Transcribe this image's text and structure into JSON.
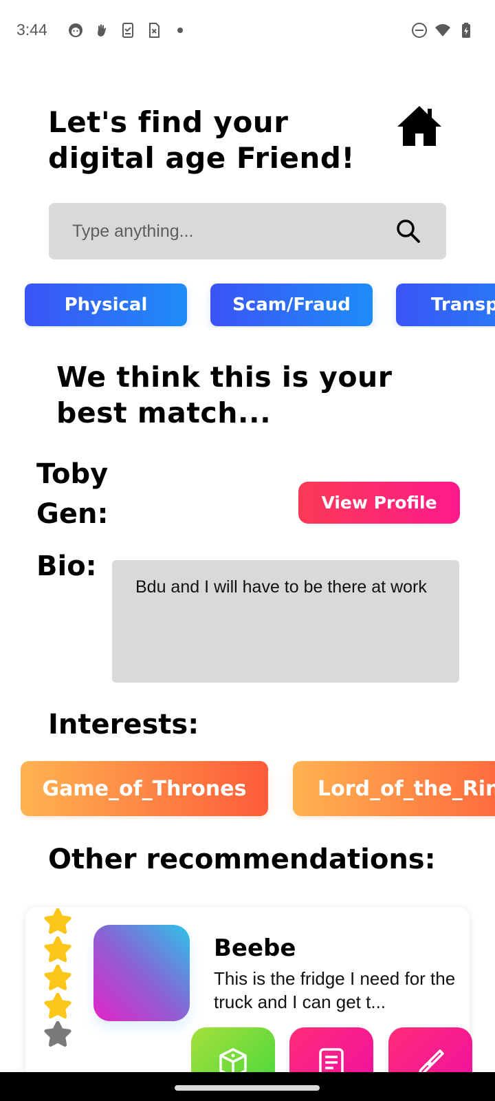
{
  "status_bar": {
    "time": "3:44",
    "left_icons": [
      "face-icon",
      "hand-icon",
      "clipboard-icon",
      "sim-off-icon",
      "dot-icon"
    ],
    "right_icons": [
      "do-not-disturb-icon",
      "wifi-icon",
      "battery-charging-icon"
    ]
  },
  "header": {
    "title": "Let's find your digital age Friend!",
    "home_icon": "home-icon"
  },
  "search": {
    "placeholder": "Type anything...",
    "icon": "search-icon"
  },
  "categories": [
    {
      "label": "Physical"
    },
    {
      "label": "Scam/Fraud"
    },
    {
      "label": "Transport"
    }
  ],
  "match": {
    "heading": "We think this is your best match...",
    "name": "Toby",
    "gen_label": "Gen:",
    "view_profile_label": "View Profile",
    "bio_label": "Bio:",
    "bio_text": "Bdu and I will have to be there at work"
  },
  "interests": {
    "label": "Interests:",
    "items": [
      {
        "label": "Game_of_Thrones"
      },
      {
        "label": "Lord_of_the_Rings"
      }
    ]
  },
  "other_recommendations": {
    "label": "Other recommendations:",
    "cards": [
      {
        "name": "Beebe",
        "description": "This is the fridge I need for the truck and I can get t...",
        "rating": 4,
        "max_rating": 5
      }
    ]
  },
  "colors": {
    "chip_gradient_start": "#3b54f6",
    "chip_gradient_end": "#1e8cf7",
    "view_profile_start": "#fb3a55",
    "view_profile_end": "#fd1a8c",
    "interest_start": "#ffb350",
    "interest_end": "#fe5c3a",
    "star_active": "#fbc51a",
    "star_inactive": "#7a7a7a"
  },
  "action_buttons": [
    {
      "icon": "dice-icon"
    },
    {
      "icon": "document-icon"
    },
    {
      "icon": "paintbrush-icon"
    }
  ]
}
